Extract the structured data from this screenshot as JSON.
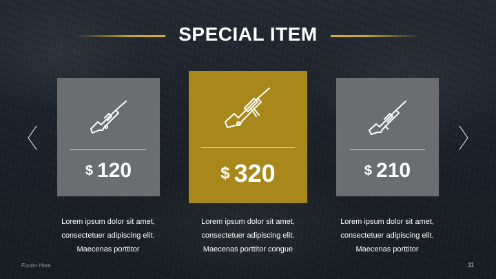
{
  "slide": {
    "title": "SPECIAL ITEM",
    "footer": "Footer Here",
    "page_number": "11",
    "accent_color": "#c9a02b"
  },
  "cards": [
    {
      "icon": "rifle-icon",
      "currency": "$",
      "price": "120",
      "description": [
        "Lorem ipsum dolor sit amet,",
        "consectetuer adipiscing elit.",
        "Maecenas porttitor"
      ]
    },
    {
      "icon": "sniper-rifle-icon",
      "currency": "$",
      "price": "320",
      "description": [
        "Lorem ipsum dolor sit amet,",
        "consectetuer adipiscing elit.",
        "Maecenas porttitor congue"
      ]
    },
    {
      "icon": "scoped-rifle-icon",
      "currency": "$",
      "price": "210",
      "description": [
        "Lorem ipsum dolor sit amet,",
        "consectetuer adipiscing elit.",
        "Maecenas porttitor"
      ]
    }
  ],
  "nav": {
    "prev_icon": "chevron-left-icon",
    "next_icon": "chevron-right-icon"
  }
}
